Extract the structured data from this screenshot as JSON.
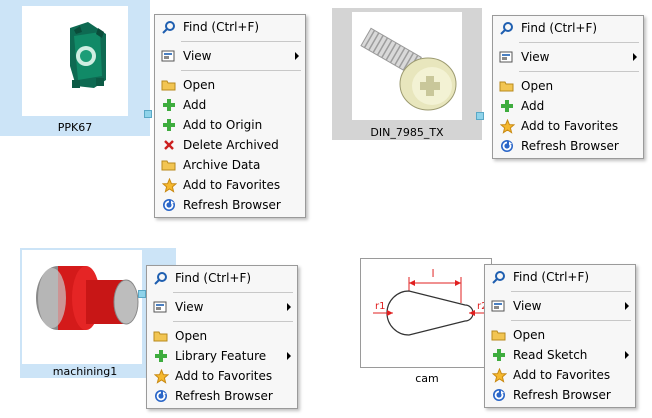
{
  "tiles": [
    {
      "caption": "PPK67",
      "menu": {
        "find": "Find (Ctrl+F)",
        "view": "View",
        "items": [
          "Open",
          "Add",
          "Add to Origin",
          "Delete Archived",
          "Archive Data",
          "Add to Favorites",
          "Refresh Browser"
        ]
      }
    },
    {
      "caption": "DIN_7985_TX",
      "menu": {
        "find": "Find (Ctrl+F)",
        "view": "View",
        "items": [
          "Open",
          "Add",
          "Add to Favorites",
          "Refresh Browser"
        ]
      }
    },
    {
      "caption": "machining1",
      "menu": {
        "find": "Find (Ctrl+F)",
        "view": "View",
        "items": [
          "Open",
          "Library Feature",
          "Add to Favorites",
          "Refresh Browser"
        ]
      }
    },
    {
      "caption": "cam",
      "sketch_labels": [
        "l",
        "r1",
        "r2"
      ],
      "menu": {
        "find": "Find (Ctrl+F)",
        "view": "View",
        "items": [
          "Open",
          "Read Sketch",
          "Add to Favorites",
          "Refresh Browser"
        ]
      }
    }
  ],
  "colors": {
    "selection": "#cce4f7",
    "selection_gray": "#d4d4d4",
    "menu_bg": "#f7f7f7",
    "dimension_red": "#e02020"
  }
}
